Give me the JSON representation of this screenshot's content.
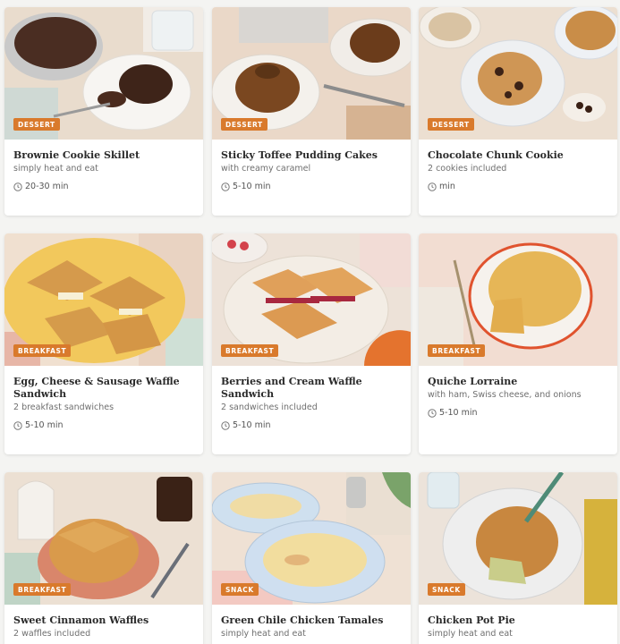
{
  "cards": [
    {
      "category": "DESSERT",
      "title": "Brownie Cookie Skillet",
      "subtitle": "simply heat and eat",
      "time": "20-30 min",
      "food_icon": "brownie-skillet-photo"
    },
    {
      "category": "DESSERT",
      "title": "Sticky Toffee Pudding Cakes",
      "subtitle": "with creamy caramel",
      "time": "5-10 min",
      "food_icon": "pudding-cake-photo"
    },
    {
      "category": "DESSERT",
      "title": "Chocolate Chunk Cookie",
      "subtitle": "2 cookies included",
      "time": "min",
      "food_icon": "cookie-photo"
    },
    {
      "category": "BREAKFAST",
      "title": "Egg, Cheese & Sausage Waffle Sandwich",
      "subtitle": "2 breakfast sandwiches",
      "time": "5-10 min",
      "food_icon": "waffle-sandwich-photo"
    },
    {
      "category": "BREAKFAST",
      "title": "Berries and Cream Waffle Sandwich",
      "subtitle": "2 sandwiches included",
      "time": "5-10 min",
      "food_icon": "berry-waffle-photo"
    },
    {
      "category": "BREAKFAST",
      "title": "Quiche Lorraine",
      "subtitle": "with ham, Swiss cheese, and onions",
      "time": "5-10 min",
      "food_icon": "quiche-photo"
    },
    {
      "category": "BREAKFAST",
      "title": "Sweet Cinnamon Waffles",
      "subtitle": "2 waffles included",
      "time": "",
      "food_icon": "waffles-photo"
    },
    {
      "category": "SNACK",
      "title": "Green Chile Chicken Tamales",
      "subtitle": "simply heat and eat",
      "time": "",
      "food_icon": "tamales-photo"
    },
    {
      "category": "SNACK",
      "title": "Chicken Pot Pie",
      "subtitle": "simply heat and eat",
      "time": "",
      "food_icon": "pot-pie-photo"
    }
  ],
  "colors": {
    "badge": "#d97a2c",
    "card_bg": "#ffffff",
    "page_bg": "#f4f4f2"
  }
}
